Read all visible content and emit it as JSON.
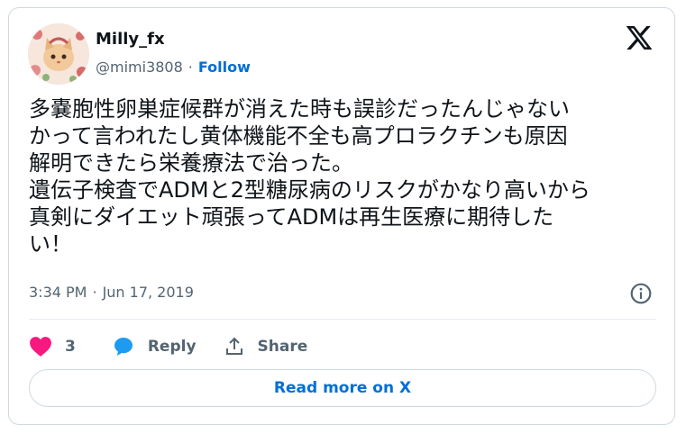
{
  "author": {
    "name": "Milly_fx",
    "handle": "@mimi3808",
    "separator": "·",
    "follow_label": "Follow"
  },
  "tweet": {
    "text": "多嚢胞性卵巣症候群が消えた時も誤診だったんじゃない\nかって言われたし黄体機能不全も高プロラクチンも原因\n解明できたら栄養療法で治った。\n遺伝子検査でADMと2型糖尿病のリスクがかなり高いから\n真剣にダイエット頑張ってADMは再生医療に期待した\nい！",
    "time": "3:34 PM",
    "separator": "·",
    "date": "Jun 17, 2019"
  },
  "actions": {
    "like_count": "3",
    "reply_label": "Reply",
    "share_label": "Share"
  },
  "read_more_label": "Read more on X",
  "colors": {
    "accent": "#006fd6",
    "like": "#f91880",
    "reply": "#1d9bf0",
    "muted": "#536471",
    "text": "#0f1419",
    "border": "#cfd9de"
  },
  "icons": [
    "x-logo-icon",
    "info-icon",
    "heart-icon",
    "reply-icon",
    "share-icon"
  ]
}
